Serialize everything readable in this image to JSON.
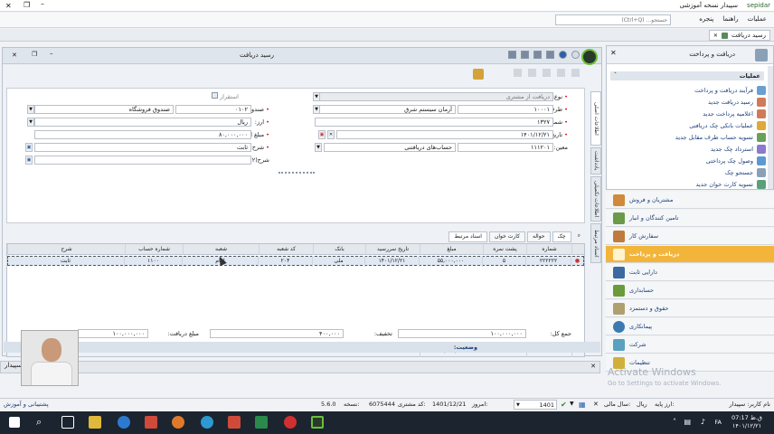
{
  "window": {
    "title": "سپیدار نسخه آموزشی",
    "app_name": "sepidar"
  },
  "menu": {
    "items": [
      "عملیات",
      "راهنما",
      "پنجره"
    ],
    "search_placeholder": "جستجو... (Ctrl+Q)"
  },
  "tab": {
    "label": "رسید دریافت"
  },
  "form": {
    "title": "رسید دریافت",
    "fields": {
      "type_label": "نوع:",
      "type_value": "دریافت از مشتری",
      "party_label": "طرف مقابل:",
      "party_code": "۱۰۰۰۱",
      "party_value": "آرمان سیستم شرق",
      "number_label": "شماره:",
      "number_value": "۱۳۲۷",
      "date_label": "تاریخ:",
      "date_value": "۱۴۰۱/۱۲/۲۱",
      "currency_label": "ارز:",
      "currency_value": "ریال",
      "amount_label": "مبلغ ارز:",
      "amount_value": "۸۰,۰۰۰,۰۰۰",
      "desc_label": "شرح:",
      "desc_value": "ثابت",
      "desc2_label": "شرح(۲):",
      "desc2_value": "",
      "cashbox_label": "صندوق:",
      "cashbox_code": "۰۱۰۲",
      "cashbox_value": "صندوق فروشگاه",
      "consume_label": "استقرار",
      "dim_label": "معین:",
      "dim_code": "۱۱۱۲۰۱",
      "dim_value": "حساب‌های دریافتنی"
    },
    "side_tabs": [
      "اطلاعات اصلی",
      "یادداشت",
      "اطلاعات تکمیلی",
      "اسناد مرتبط"
    ],
    "grid_tabs": [
      "چک",
      "حواله",
      "کارت خوان",
      "اسناد مرتبط"
    ],
    "grid": {
      "headers": [
        "شماره",
        "پشت نمره",
        "مبلغ",
        "تاریخ سررسید",
        "بانک",
        "کد شعبه",
        "شعبه",
        "شماره حساب",
        "شرح"
      ],
      "row": [
        "۲۲۲۲۲۲",
        "۵",
        "۵۵,۰۰۰,۰۰۰",
        "۱۴۰۱/۱۲/۲۱",
        "ملی",
        "۲۰۴",
        "امام",
        "۱۱۰۰",
        "ثابت"
      ],
      "footer_count": "۱",
      "footer_sum": "۵۵,۰۰۰,۰۰۰"
    },
    "totals": {
      "total_label": "جمع کل:",
      "total_value": "۱۰۰,۰۰۰,۰۰۰",
      "discount_label": "تخفیف:",
      "discount_value": "۴۰۰,۰۰۰",
      "received_label": "مبلغ دریافت:",
      "received_value": "۱۰۰,۰۰۰,۰۰۰"
    },
    "status_label": "وضعیت:"
  },
  "right_panel": {
    "title": "دریافت و پرداخت",
    "section": "عملیات",
    "items": [
      "فرآیند دریافت و پرداخت",
      "رسید دریافت جدید",
      "اعلامیه پرداخت جدید",
      "عملیات بانکی چک دریافتی",
      "تسویه حساب طرف مقابل جدید",
      "استرداد چک جدید",
      "وصول چک پرداختی",
      "جستجو چک",
      "تسویه کارت خوان جدید"
    ]
  },
  "modules": [
    "مشتریان و فروش",
    "تامین کنندگان و انبار",
    "سفارش کار",
    "دریافت و پرداخت",
    "دارایی ثابت",
    "حسابداری",
    "حقوق و دستمزد",
    "پیمانکاری",
    "شرکت",
    "تنظیمات"
  ],
  "bottom": {
    "support": "پشتیبانی و آموزش",
    "version_label": "نسخه:",
    "version": "5.6.0",
    "customer_label": "کد مشتری:",
    "customer": "6075444",
    "today_label": "امروز:",
    "today": "1401/12/21",
    "year_label": "سال مالی:",
    "year": "1401",
    "currency_label": "ارز پایه:",
    "currency": "ریال",
    "user": "نام کاربر: سپیدار"
  },
  "desktop": {
    "watermark_title": "Activate Windows",
    "watermark_sub": "Go to Settings to activate Windows.",
    "clock_time": "07:17",
    "clock_lang": "FA",
    "clock_ampm": "ق.ظ",
    "clock_date": "۱۴۰۱/۱۲/۲۱"
  },
  "colors": {
    "active_module": "#f2b53a",
    "link": "#1d3f7a",
    "required": "#dd0000"
  }
}
